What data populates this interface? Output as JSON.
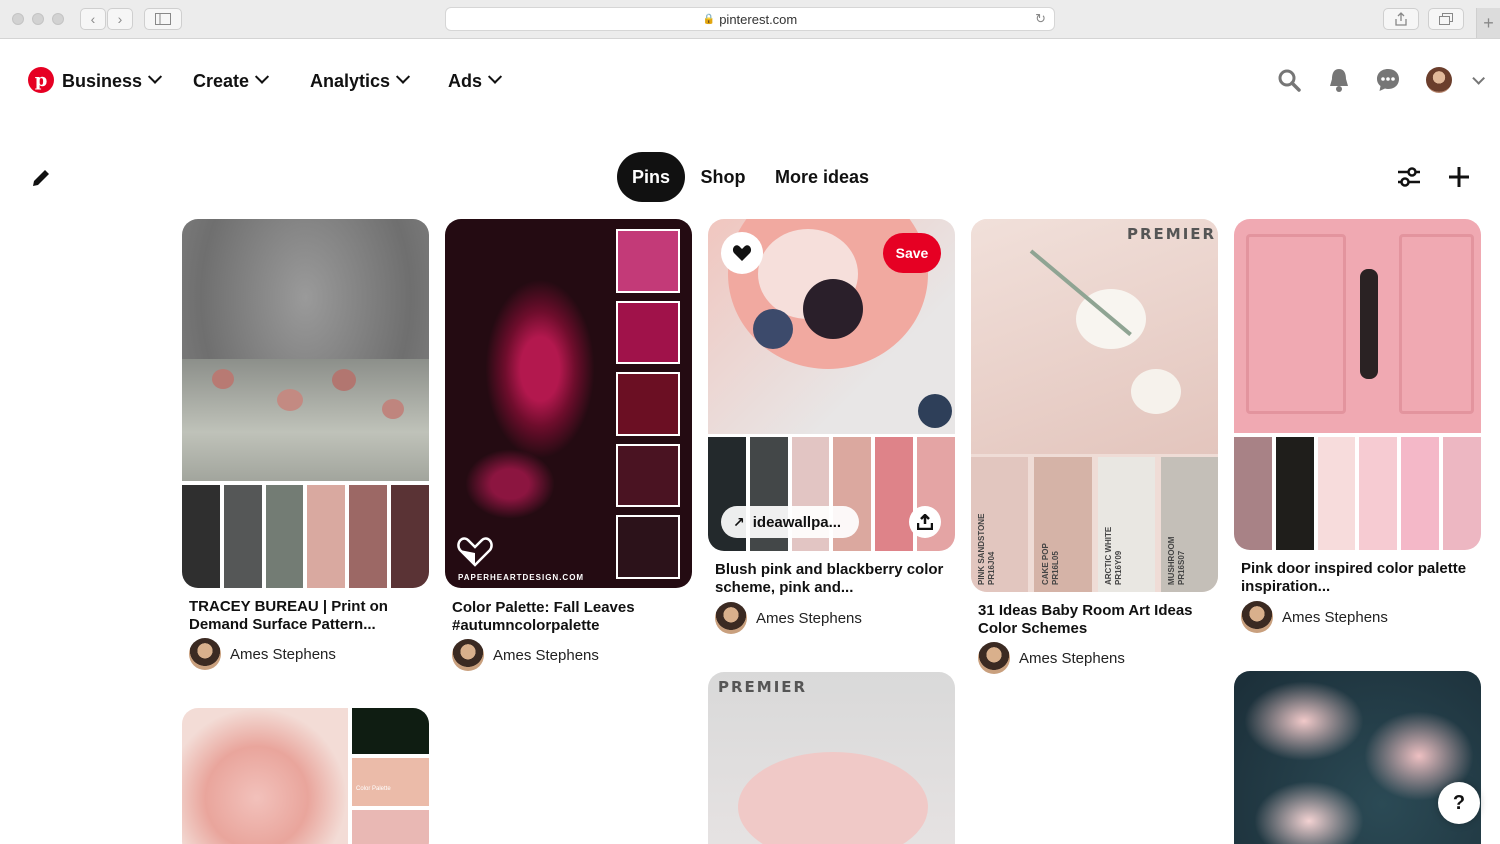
{
  "browser": {
    "url": "pinterest.com"
  },
  "nav": {
    "items": [
      "Business",
      "Create",
      "Analytics",
      "Ads"
    ]
  },
  "tabs": [
    "Pins",
    "Shop",
    "More ideas"
  ],
  "pins": [
    {
      "title": "TRACEY BUREAU | Print on Demand Surface Pattern...",
      "author": "Ames Stephens",
      "swatches": [
        "#2f2f2f",
        "#555757",
        "#737c74",
        "#d9a9a0",
        "#9c6865",
        "#5a3335"
      ]
    },
    {
      "title": "Color Palette: Fall Leaves #autumncolorpalette",
      "author": "Ames Stephens",
      "brand": "PAPERHEARTDESIGN.COM",
      "swatches": [
        "#c33a78",
        "#a0124a",
        "#6b0f23",
        "#4a1322",
        "#2c121a"
      ]
    },
    {
      "title": "Blush pink and blackberry color scheme, pink and...",
      "author": "Ames Stephens",
      "link": "ideawallpa...",
      "save_label": "Save",
      "swatches": [
        "#23292c",
        "#434748",
        "#e2c5c3",
        "#dba89f",
        "#de8389",
        "#e4a4a4"
      ]
    },
    {
      "title": "31 Ideas Baby Room Art Ideas Color Schemes",
      "author": "Ames Stephens",
      "brand": "PREMIER",
      "swatch_labels": [
        "PINK SANDSTONE",
        "CAKE POP",
        "ARCTIC WHITE",
        "MUSHROOM"
      ],
      "swatch_codes": [
        "PR16J04",
        "PR16L05",
        "PR16Y09",
        "PR16S07"
      ],
      "swatches": [
        "#e2c6bf",
        "#d5b3a7",
        "#e9e7e2",
        "#c4bfb8"
      ]
    },
    {
      "title": "Pink door inspired color palette inspiration...",
      "author": "Ames Stephens",
      "swatches": [
        "#a88286",
        "#1f1e1b",
        "#f7dcdc",
        "#f6cbd2",
        "#f4b8c8",
        "#edb7c2"
      ]
    }
  ],
  "lower_pins": {
    "brand": "PREMIER",
    "mini_label": "Color Palette"
  },
  "help_label": "?",
  "colors": {
    "brand_red": "#e60023"
  }
}
